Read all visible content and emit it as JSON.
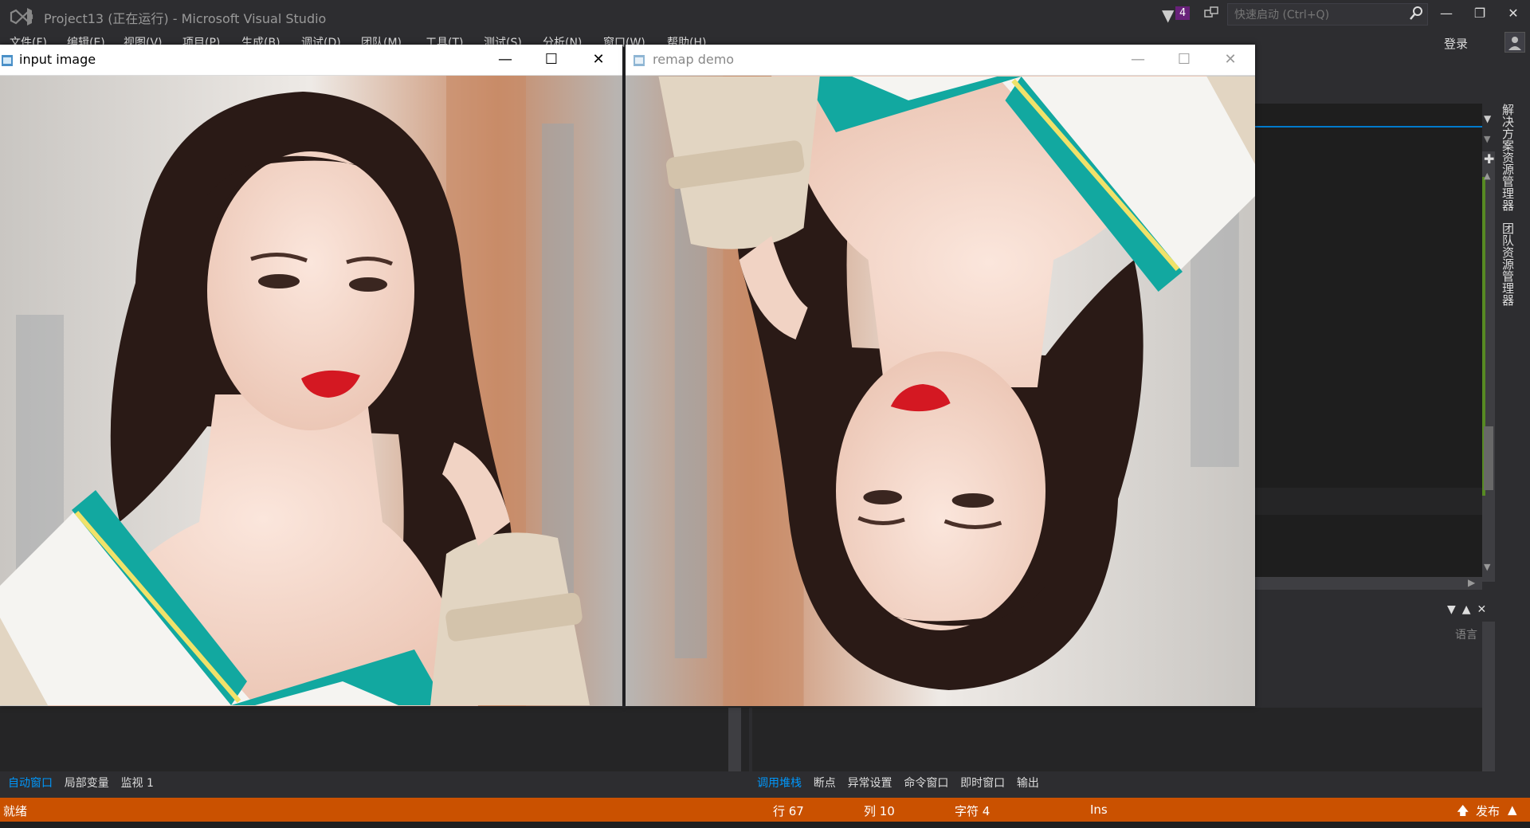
{
  "window": {
    "title": "Project13 (正在运行) - Microsoft Visual Studio",
    "filter_count": "4",
    "quick_launch_placeholder": "快速启动 (Ctrl+Q)",
    "login": "登录"
  },
  "menu": [
    "文件(F)",
    "编辑(E)",
    "视图(V)",
    "项目(P)",
    "生成(B)",
    "调试(D)",
    "团队(M)",
    "工具(T)",
    "测试(S)",
    "分析(N)",
    "窗口(W)",
    "帮助(H)"
  ],
  "side_tabs": [
    "解决方案资源管理器",
    "团队资源管理器"
  ],
  "right_panel": {
    "lang_label": "语言"
  },
  "bottom_tabs_left": [
    {
      "label": "自动窗口",
      "active": true
    },
    {
      "label": "局部变量",
      "active": false
    },
    {
      "label": "监视 1",
      "active": false
    }
  ],
  "bottom_tabs_right": [
    {
      "label": "调用堆栈",
      "active": true
    },
    {
      "label": "断点",
      "active": false
    },
    {
      "label": "异常设置",
      "active": false
    },
    {
      "label": "命令窗口",
      "active": false
    },
    {
      "label": "即时窗口",
      "active": false
    },
    {
      "label": "输出",
      "active": false
    }
  ],
  "status": {
    "ready": "就绪",
    "line": "行 67",
    "col": "列 10",
    "char": "字符 4",
    "ins": "Ins",
    "publish": "发布"
  },
  "image_windows": [
    {
      "title": "input image",
      "state": "active"
    },
    {
      "title": "remap demo",
      "state": "inactive"
    }
  ],
  "colors": {
    "status_bar": "#ca5100",
    "accent": "#007acc",
    "active_tab": "#0097fb",
    "badge": "#68217a"
  }
}
